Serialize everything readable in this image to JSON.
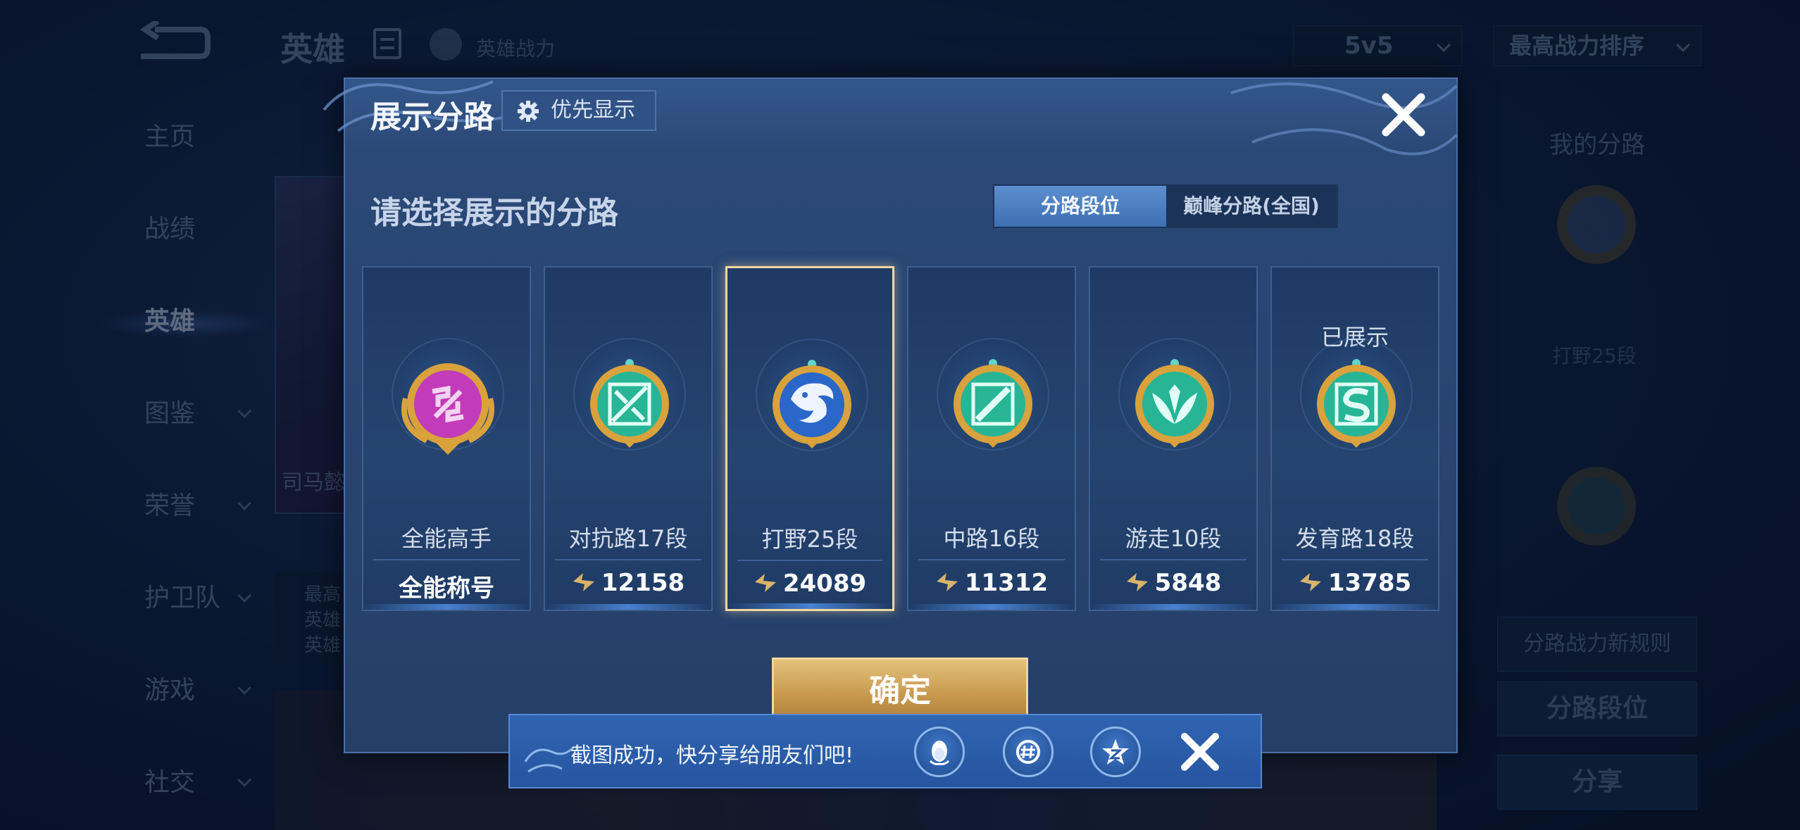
{
  "background": {
    "page_title": "英雄",
    "hero_power_label": "英雄战力",
    "mode_select": "5v5",
    "sort_select": "最高战力排序",
    "side_nav": [
      {
        "label": "主页",
        "caret": false,
        "active": false
      },
      {
        "label": "战绩",
        "caret": false,
        "active": false
      },
      {
        "label": "英雄",
        "caret": false,
        "active": true
      },
      {
        "label": "图鉴",
        "caret": true,
        "active": false
      },
      {
        "label": "荣誉",
        "caret": true,
        "active": false
      },
      {
        "label": "护卫队",
        "caret": true,
        "active": false
      },
      {
        "label": "游戏",
        "caret": true,
        "active": false
      },
      {
        "label": "社交",
        "caret": true,
        "active": false
      }
    ],
    "hero_card_name": "司马懿",
    "hero_info_lines": [
      "最高",
      "英雄",
      "英雄"
    ],
    "right_panel": {
      "title": "我的分路",
      "lane_label": "打野25段",
      "rules_button": "分路战力新规则",
      "lane_rank_button": "分路段位",
      "share_button": "分享"
    }
  },
  "modal": {
    "title": "展示分路",
    "priority_button": "优先显示",
    "prompt": "请选择展示的分路",
    "tabs": [
      {
        "label": "分路段位",
        "active": true
      },
      {
        "label": "巅峰分路(全国)",
        "active": false
      }
    ],
    "cards": [
      {
        "name": "全能高手",
        "value": "全能称号",
        "show_power_icon": false,
        "selected": false,
        "shown_label": "",
        "emblem": "all-round-emblem-icon",
        "emblem_color": "#c23bb8"
      },
      {
        "name": "对抗路17段",
        "value": "12158",
        "show_power_icon": true,
        "selected": false,
        "shown_label": "",
        "emblem": "clash-lane-emblem-icon",
        "emblem_color": "#2fbfa0"
      },
      {
        "name": "打野25段",
        "value": "24089",
        "show_power_icon": true,
        "selected": true,
        "shown_label": "",
        "emblem": "jungle-dragon-emblem-icon",
        "emblem_color": "#2a67c9"
      },
      {
        "name": "中路16段",
        "value": "11312",
        "show_power_icon": true,
        "selected": false,
        "shown_label": "",
        "emblem": "mid-lane-emblem-icon",
        "emblem_color": "#2fbfa0"
      },
      {
        "name": "游走10段",
        "value": "5848",
        "show_power_icon": true,
        "selected": false,
        "shown_label": "",
        "emblem": "roam-wings-emblem-icon",
        "emblem_color": "#2fbfa0"
      },
      {
        "name": "发育路18段",
        "value": "13785",
        "show_power_icon": true,
        "selected": false,
        "shown_label": "已展示",
        "emblem": "farm-lane-emblem-icon",
        "emblem_color": "#2fbfa0"
      }
    ],
    "confirm_button": "确定"
  },
  "toast": {
    "message": "截图成功，快分享给朋友们吧!",
    "icons": [
      "qq-penguin-icon",
      "wechat-moments-icon",
      "qzone-star-icon"
    ]
  },
  "colors": {
    "accent_gold": "#f1d7a0",
    "modal_bg": "#2a4773",
    "emblem_gold": "#d9a23d",
    "toast_bg": "#2d5fab"
  }
}
